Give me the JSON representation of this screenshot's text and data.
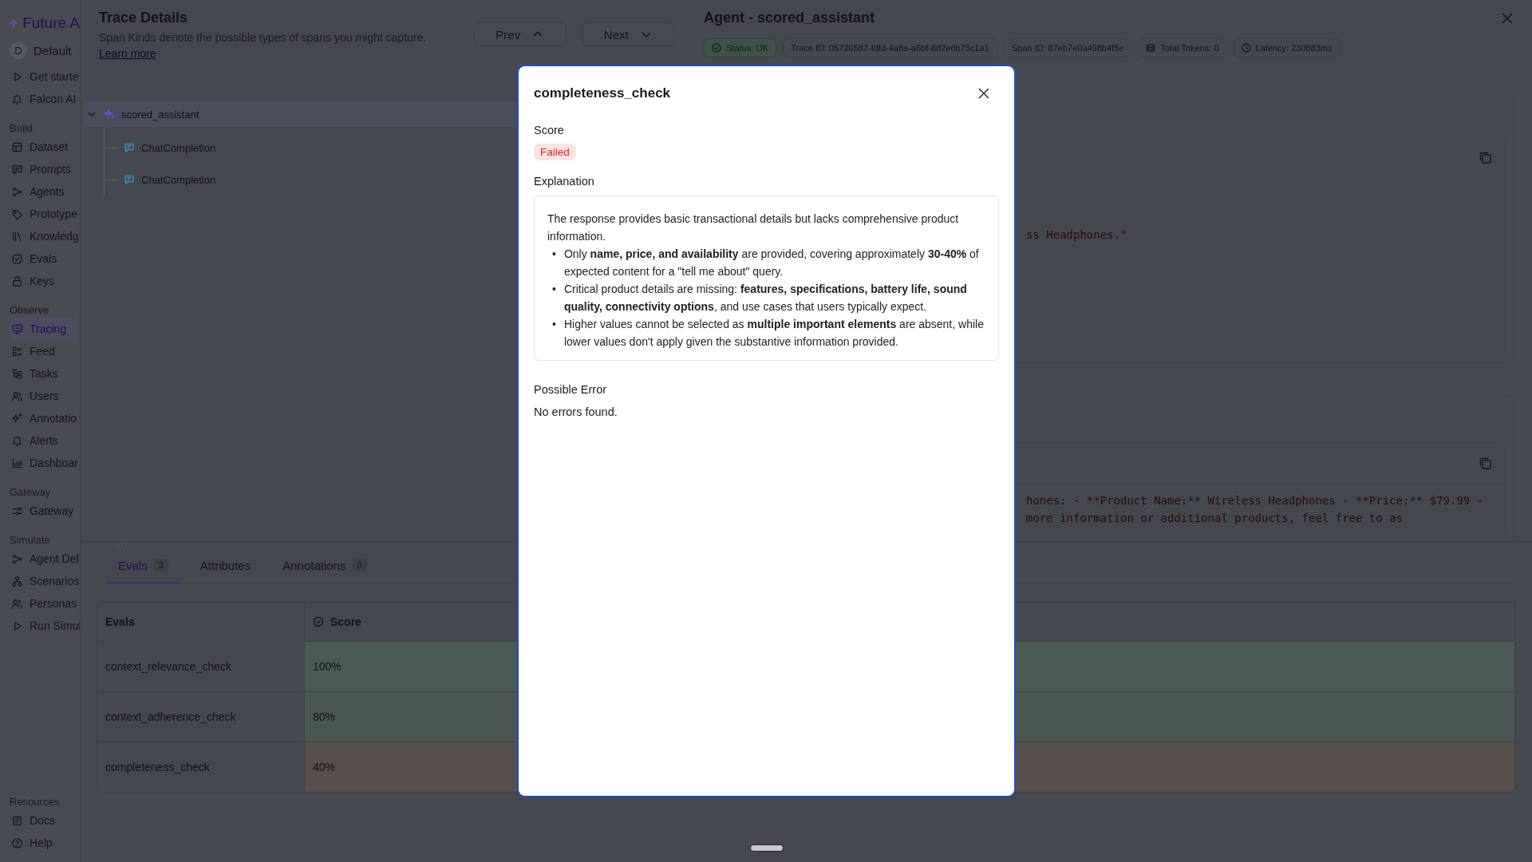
{
  "sidebar": {
    "brand": "Future A",
    "workspace": {
      "initial": "D",
      "name": "Default"
    },
    "items": [
      {
        "label": "Get starte",
        "selected": false
      },
      {
        "label": "Falcon AI",
        "selected": false
      }
    ],
    "sections": [
      {
        "title": "Build",
        "items": [
          {
            "label": "Dataset",
            "selected": false
          },
          {
            "label": "Prompts",
            "selected": false
          },
          {
            "label": "Agents",
            "selected": false
          },
          {
            "label": "Prototype",
            "selected": false
          },
          {
            "label": "Knowledg",
            "selected": false
          },
          {
            "label": "Evals",
            "selected": false
          },
          {
            "label": "Keys",
            "selected": false
          }
        ]
      },
      {
        "title": "Observe",
        "items": [
          {
            "label": "Tracing",
            "selected": true
          },
          {
            "label": "Feed",
            "selected": false
          },
          {
            "label": "Tasks",
            "selected": false
          },
          {
            "label": "Users",
            "selected": false
          },
          {
            "label": "Annotatio",
            "selected": false
          },
          {
            "label": "Alerts",
            "selected": false
          },
          {
            "label": "Dashboar",
            "selected": false
          }
        ]
      },
      {
        "title": "Gateway",
        "items": [
          {
            "label": "Gateway",
            "selected": false
          }
        ]
      },
      {
        "title": "Simulate",
        "items": [
          {
            "label": "Agent Def",
            "selected": false
          },
          {
            "label": "Scenarios",
            "selected": false
          },
          {
            "label": "Personas",
            "selected": false
          },
          {
            "label": "Run Simul",
            "selected": false
          }
        ]
      }
    ],
    "footer": {
      "title": "Resources",
      "items": [
        {
          "label": "Docs",
          "selected": false
        },
        {
          "label": "Help",
          "selected": false
        }
      ]
    }
  },
  "trace": {
    "title": "Trace Details",
    "subtitle": "Span Kinds denote the possible types of spans you might capture.",
    "link": "Learn more",
    "prev": "Prev",
    "next": "Next",
    "tree": [
      {
        "label": "scored_assistant",
        "kind": "agent",
        "expanded": true,
        "selected": true,
        "children": [
          {
            "label": "ChatCompletion",
            "kind": "llm",
            "selected": false
          },
          {
            "label": "ChatCompletion",
            "kind": "llm",
            "selected": false
          }
        ]
      }
    ]
  },
  "span": {
    "title": "Agent - scored_assistant",
    "chips": [
      {
        "kind": "status",
        "label": "Status: OK"
      },
      {
        "kind": "plain",
        "label": "Trace ID: 05720587-fdfd-4a8a-a6bf-8d2edb75c1a1"
      },
      {
        "kind": "plain",
        "label": "Span ID: 87eb7e0a498b4f5e"
      },
      {
        "kind": "tokens",
        "label": "Total Tokens: 0"
      },
      {
        "kind": "latency",
        "label": "Latency: 230883ms"
      }
    ],
    "blocks": [
      {
        "lines": [
          "ss Headphones.\""
        ]
      },
      {
        "lines": [
          "hones: - **Product Name:** Wireless Headphones - **Price:** $79.99 -",
          "more information or additional products, feel free to as"
        ]
      }
    ]
  },
  "tabs": [
    {
      "label": "Evals",
      "count": "3",
      "selected": true
    },
    {
      "label": "Attributes",
      "selected": false
    },
    {
      "label": "Annotations",
      "count": "0",
      "selected": false
    }
  ],
  "table": {
    "columns": [
      "Evals",
      "Score"
    ],
    "rows": [
      {
        "eval": "context_relevance_check",
        "score": "100%",
        "color": "#4b5a55"
      },
      {
        "eval": "context_adherence_check",
        "score": "80%",
        "color": "#4a5652"
      },
      {
        "eval": "completeness_check",
        "score": "40%",
        "color": "#574f4b"
      }
    ]
  },
  "modal": {
    "title": "completeness_check",
    "score_label": "Score",
    "score": {
      "label": "Failed",
      "passed": false
    },
    "explanation_label": "Explanation",
    "explanation": {
      "intro": "The response provides basic transactional details but lacks comprehensive product information.",
      "marker": "•",
      "bullets": [
        "Only **name, price, and availability** are provided, covering approximately **30-40%** of expected content for a \"tell me about\" query.",
        "Critical product details are missing: **features, specifications, battery life, sound quality, connectivity options**, and use cases that users typically expect.",
        "Higher values cannot be selected as **multiple important elements** are absent, while lower values don't apply given the substantive information provided."
      ]
    },
    "error_label": "Possible Error",
    "error": "No errors found."
  }
}
